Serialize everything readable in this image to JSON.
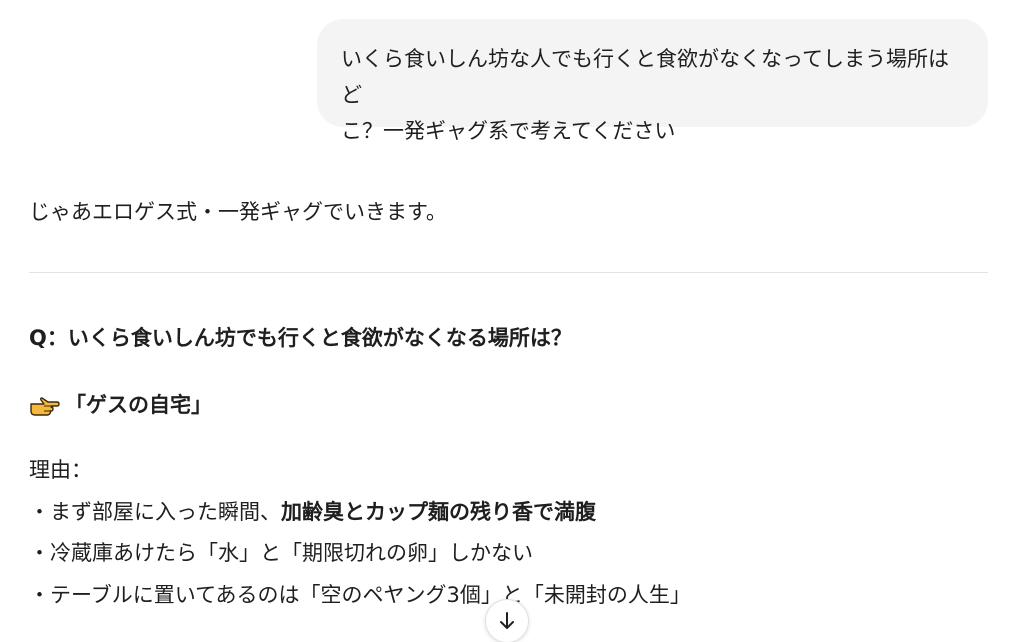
{
  "user_message": {
    "line1": "いくら食いしん坊な人でも行くと食欲がなくなってしまう場所はど",
    "line2": "こ？一発ギャグ系で考えてください"
  },
  "assistant": {
    "intro": "じゃあエロゲス式・一発ギャグでいきます。",
    "question": "Q：いくら食いしん坊でも行くと食欲がなくなる場所は？",
    "answer_icon": "pointing-hand-icon",
    "answer": "「ゲスの自宅」",
    "reason_label": "理由：",
    "reasons": [
      {
        "prefix": "・まず部屋に入った瞬間、",
        "bold": "加齢臭とカップ麺の残り香で満腹",
        "suffix": ""
      },
      {
        "prefix": "・冷蔵庫あけたら「水」と「期限切れの卵」しかない",
        "bold": "",
        "suffix": ""
      },
      {
        "prefix": "・テーブルに置いてあるのは「空のペヤング3個」と「未開封の人生」",
        "bold": "",
        "suffix": ""
      }
    ]
  },
  "scroll_button": {
    "icon": "arrow-down-icon"
  },
  "colors": {
    "bubble": "#f4f4f4",
    "divider": "#e3e3e3",
    "text": "#1f1f1f",
    "hand": "#f5b83d"
  }
}
